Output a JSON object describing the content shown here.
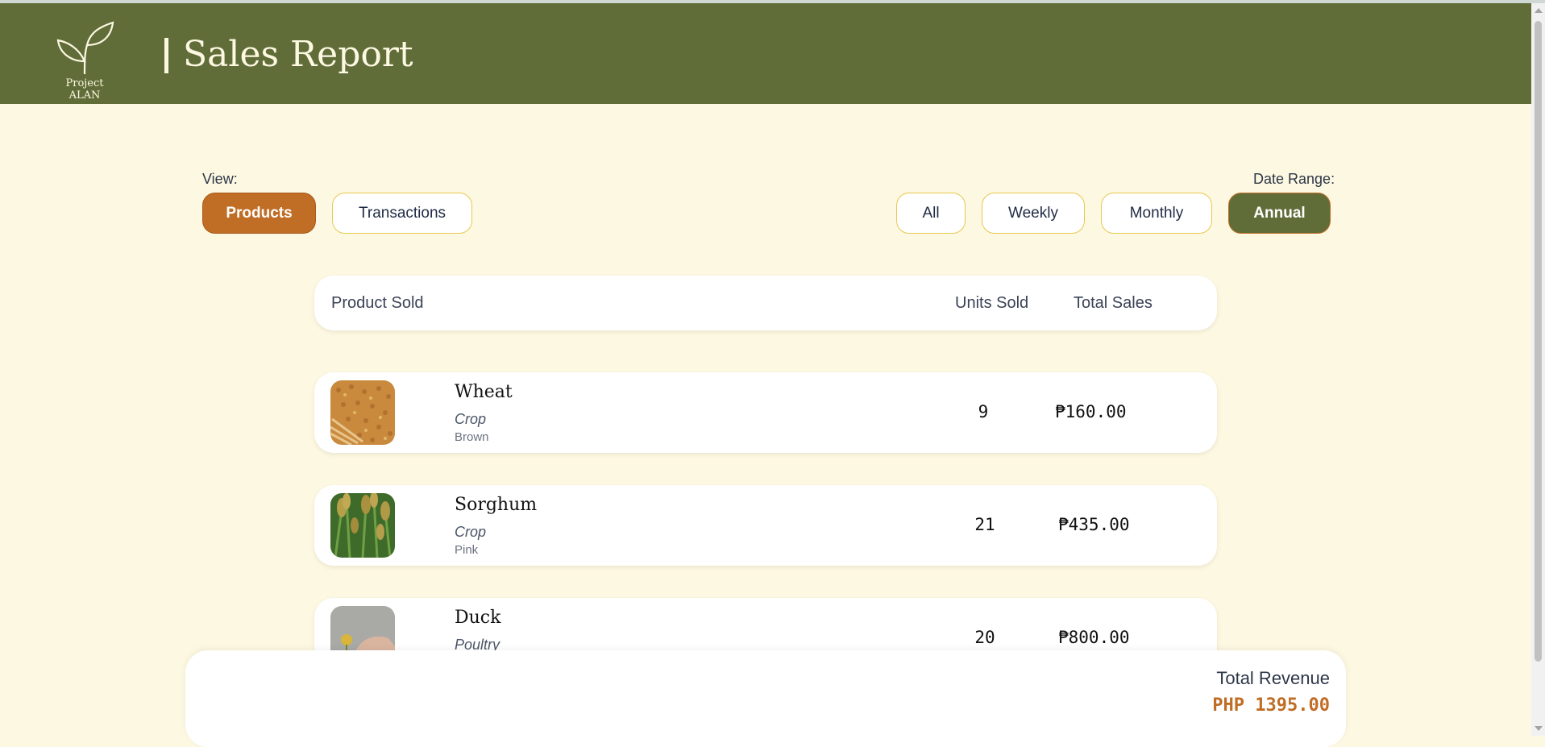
{
  "header": {
    "logo_text": "Project ALAN",
    "title": "Sales Report"
  },
  "view": {
    "label": "View:",
    "options": [
      "Products",
      "Transactions"
    ],
    "selected": "Products"
  },
  "date_range": {
    "label": "Date Range:",
    "options": [
      "All",
      "Weekly",
      "Monthly",
      "Annual"
    ],
    "selected": "Annual"
  },
  "table": {
    "headers": {
      "product": "Product Sold",
      "units": "Units Sold",
      "sales": "Total Sales"
    },
    "rows": [
      {
        "name": "Wheat",
        "category": "Crop",
        "variety": "Brown",
        "units": "9",
        "sales": "₱160.00",
        "image": "wheat-image"
      },
      {
        "name": "Sorghum",
        "category": "Crop",
        "variety": "Pink",
        "units": "21",
        "sales": "₱435.00",
        "image": "sorghum-image"
      },
      {
        "name": "Duck",
        "category": "Poultry",
        "variety": "",
        "units": "20",
        "sales": "₱800.00",
        "image": "duck-image"
      }
    ]
  },
  "footer": {
    "revenue_label": "Total Revenue",
    "revenue_value": "PHP 1395.00"
  },
  "colors": {
    "header_bg": "#606d39",
    "page_bg": "#fdf8e1",
    "accent_orange": "#c06d25",
    "accent_green": "#606d39",
    "pill_border": "#e8c84e"
  }
}
